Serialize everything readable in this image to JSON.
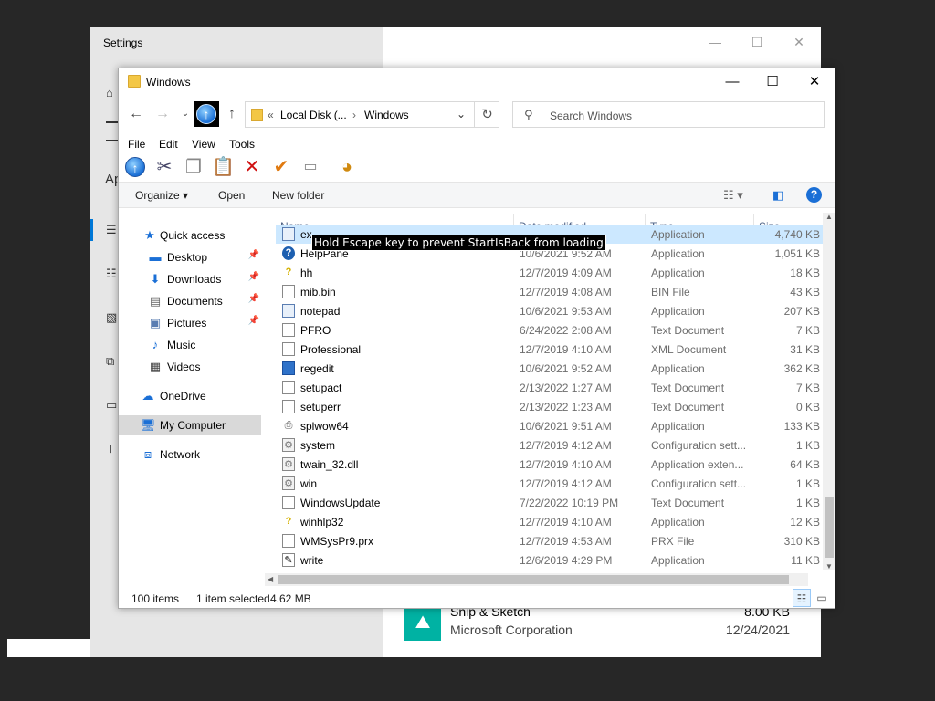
{
  "settings": {
    "title": "Settings",
    "section_partial": "Ap",
    "app": {
      "name": "Snip & Sketch",
      "publisher": "Microsoft Corporation",
      "size": "8.00 KB",
      "date": "12/24/2021"
    }
  },
  "explorer": {
    "title": "Windows",
    "breadcrumb": [
      "Local Disk (...",
      "Windows"
    ],
    "breadcrumb_prefix": "«",
    "search_placeholder": "Search Windows",
    "menu": [
      "File",
      "Edit",
      "View",
      "Tools"
    ],
    "commands": {
      "organize": "Organize",
      "open": "Open",
      "new_folder": "New folder"
    },
    "nav": {
      "quick_access": "Quick access",
      "desktop": "Desktop",
      "downloads": "Downloads",
      "documents": "Documents",
      "pictures": "Pictures",
      "music": "Music",
      "videos": "Videos",
      "onedrive": "OneDrive",
      "my_computer": "My Computer",
      "network": "Network"
    },
    "columns": {
      "name": "Name",
      "date": "Date modified",
      "type": "Type",
      "size": "Size"
    },
    "tooltip": "Hold Escape key to prevent StartIsBack from loading",
    "rows": [
      {
        "name": "ex",
        "date": "",
        "type": "Application",
        "size": "4,740 KB",
        "icon": "app-icon"
      },
      {
        "name": "HelpPane",
        "date": "10/6/2021 9:52 AM",
        "type": "Application",
        "size": "1,051 KB",
        "icon": "help-icon"
      },
      {
        "name": "hh",
        "date": "12/7/2019 4:09 AM",
        "type": "Application",
        "size": "18 KB",
        "icon": "question-icon"
      },
      {
        "name": "mib.bin",
        "date": "12/7/2019 4:08 AM",
        "type": "BIN File",
        "size": "43 KB",
        "icon": "file-icon"
      },
      {
        "name": "notepad",
        "date": "10/6/2021 9:53 AM",
        "type": "Application",
        "size": "207 KB",
        "icon": "notepad-icon"
      },
      {
        "name": "PFRO",
        "date": "6/24/2022 2:08 AM",
        "type": "Text Document",
        "size": "7 KB",
        "icon": "text-file-icon"
      },
      {
        "name": "Professional",
        "date": "12/7/2019 4:10 AM",
        "type": "XML Document",
        "size": "31 KB",
        "icon": "xml-file-icon"
      },
      {
        "name": "regedit",
        "date": "10/6/2021 9:52 AM",
        "type": "Application",
        "size": "362 KB",
        "icon": "regedit-icon"
      },
      {
        "name": "setupact",
        "date": "2/13/2022 1:27 AM",
        "type": "Text Document",
        "size": "7 KB",
        "icon": "text-file-icon"
      },
      {
        "name": "setuperr",
        "date": "2/13/2022 1:23 AM",
        "type": "Text Document",
        "size": "0 KB",
        "icon": "text-file-icon"
      },
      {
        "name": "splwow64",
        "date": "10/6/2021 9:51 AM",
        "type": "Application",
        "size": "133 KB",
        "icon": "printer-icon"
      },
      {
        "name": "system",
        "date": "12/7/2019 4:12 AM",
        "type": "Configuration sett...",
        "size": "1 KB",
        "icon": "config-file-icon"
      },
      {
        "name": "twain_32.dll",
        "date": "12/7/2019 4:10 AM",
        "type": "Application exten...",
        "size": "64 KB",
        "icon": "dll-file-icon"
      },
      {
        "name": "win",
        "date": "12/7/2019 4:12 AM",
        "type": "Configuration sett...",
        "size": "1 KB",
        "icon": "config-file-icon"
      },
      {
        "name": "WindowsUpdate",
        "date": "7/22/2022 10:19 PM",
        "type": "Text Document",
        "size": "1 KB",
        "icon": "text-file-icon"
      },
      {
        "name": "winhlp32",
        "date": "12/7/2019 4:10 AM",
        "type": "Application",
        "size": "12 KB",
        "icon": "question-icon"
      },
      {
        "name": "WMSysPr9.prx",
        "date": "12/7/2019 4:53 AM",
        "type": "PRX File",
        "size": "310 KB",
        "icon": "file-icon"
      },
      {
        "name": "write",
        "date": "12/6/2019 4:29 PM",
        "type": "Application",
        "size": "11 KB",
        "icon": "write-icon"
      }
    ],
    "status": {
      "count": "100 items",
      "selected": "1 item selected",
      "selected_size": "4.62 MB"
    }
  }
}
